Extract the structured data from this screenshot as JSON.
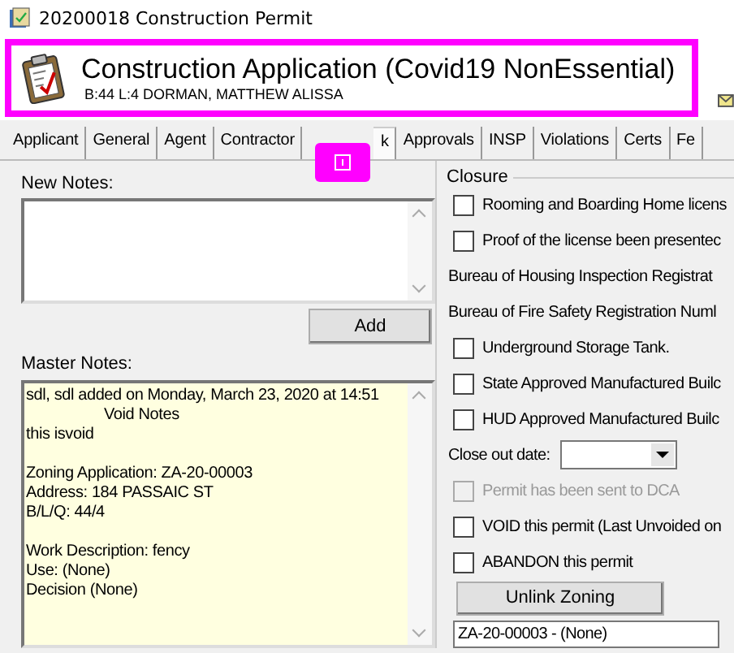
{
  "window": {
    "title": "20200018 Construction Permit"
  },
  "header": {
    "title": "Construction Application (Covid19 NonEssential)",
    "subtitle": "B:44 L:4  DORMAN, MATTHEW  ALISSA"
  },
  "tabs": [
    {
      "label": "Applicant",
      "selected": false
    },
    {
      "label": "General",
      "selected": false
    },
    {
      "label": "Agent",
      "selected": false
    },
    {
      "label": "Contractor",
      "selected": false
    },
    {
      "label": "k",
      "selected": true
    },
    {
      "label": "Approvals",
      "selected": false
    },
    {
      "label": "INSP",
      "selected": false
    },
    {
      "label": "Violations",
      "selected": false
    },
    {
      "label": "Certs",
      "selected": false
    },
    {
      "label": "Fe",
      "selected": false
    }
  ],
  "notes": {
    "new_label": "New Notes:",
    "add_button": "Add",
    "master_label": "Master Notes:",
    "master_blocks": [
      [
        {
          "text": "sdl, sdl added on Monday, March 23, 2020 at 14:51",
          "indented": false
        },
        {
          "text": "Void Notes",
          "indented": true
        },
        {
          "text": "this isvoid",
          "indented": false
        }
      ],
      [
        {
          "text": "Zoning Application: ZA-20-00003",
          "indented": false
        },
        {
          "text": "Address: 184 PASSAIC ST",
          "indented": false
        },
        {
          "text": "B/L/Q: 44/4",
          "indented": false
        }
      ],
      [
        {
          "text": "Work Description: fency",
          "indented": false
        },
        {
          "text": "Use: (None)",
          "indented": false
        },
        {
          "text": "Decision (None)",
          "indented": false
        }
      ]
    ]
  },
  "closure": {
    "title": "Closure",
    "items": [
      {
        "kind": "checkbox",
        "label": "Rooming and Boarding Home licens",
        "checked": false,
        "disabled": false
      },
      {
        "kind": "checkbox",
        "label": "Proof of the license been presentec",
        "checked": false,
        "disabled": false
      },
      {
        "kind": "label",
        "label": "Bureau of Housing Inspection Registrat"
      },
      {
        "kind": "label",
        "label": "Bureau of Fire Safety Registration Numl"
      },
      {
        "kind": "checkbox",
        "label": "Underground Storage Tank.",
        "checked": false,
        "disabled": false
      },
      {
        "kind": "checkbox",
        "label": "State Approved Manufactured Builc",
        "checked": false,
        "disabled": false
      },
      {
        "kind": "checkbox",
        "label": "HUD Approved Manufactured Builc",
        "checked": false,
        "disabled": false
      },
      {
        "kind": "date",
        "label": "Close out date:"
      },
      {
        "kind": "checkbox",
        "label": "Permit has been sent to DCA",
        "checked": false,
        "disabled": true
      },
      {
        "kind": "checkbox",
        "label": "VOID this permit (Last Unvoided on",
        "checked": false,
        "disabled": false
      },
      {
        "kind": "checkbox",
        "label": "ABANDON this permit",
        "checked": false,
        "disabled": false
      },
      {
        "kind": "button",
        "label": "Unlink Zoning"
      },
      {
        "kind": "field",
        "label": "ZA-20-00003 - (None)"
      }
    ]
  }
}
